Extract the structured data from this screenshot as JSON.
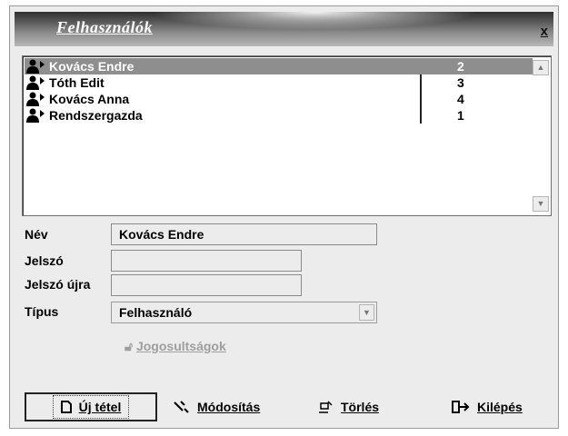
{
  "window": {
    "title": "Felhasználók",
    "close_label": "x"
  },
  "users": [
    {
      "name": "Kovács Endre",
      "value": "2",
      "selected": true
    },
    {
      "name": "Tóth Edit",
      "value": "3",
      "selected": false
    },
    {
      "name": "Kovács Anna",
      "value": "4",
      "selected": false
    },
    {
      "name": "Rendszergazda",
      "value": "1",
      "selected": false
    }
  ],
  "form": {
    "name_label": "Név",
    "name_value": "Kovács Endre",
    "password_label": "Jelszó",
    "password_value": "",
    "password_again_label": "Jelszó újra",
    "password_again_value": "",
    "type_label": "Típus",
    "type_value": "Felhasználó",
    "permissions_label": "Jogosultságok"
  },
  "buttons": {
    "new_label": "Új tétel",
    "modify_label": "Módosítás",
    "delete_label": "Törlés",
    "exit_label": "Kilépés"
  },
  "colors": {
    "selection": "#8e8e8e",
    "window_bg": "#ececec",
    "disabled_text": "#9e9e9e"
  }
}
